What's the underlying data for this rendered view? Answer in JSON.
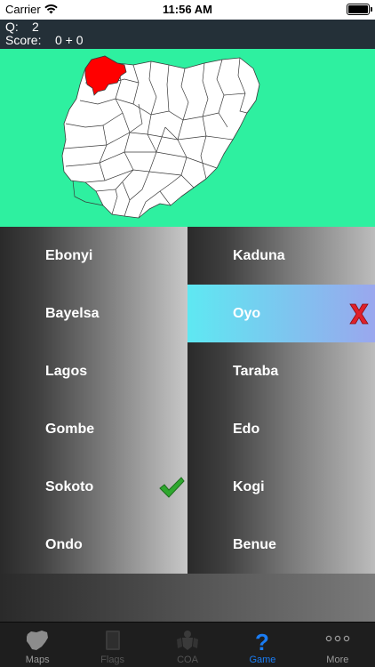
{
  "status": {
    "carrier": "Carrier",
    "time": "11:56 AM"
  },
  "info": {
    "q_label": "Q:",
    "q_value": "2",
    "score_label": "Score:",
    "score_value": "0 + 0"
  },
  "map": {
    "background_color": "#2ef0a0",
    "highlight_color": "#ff0000"
  },
  "answers": {
    "left": [
      {
        "label": "Ebonyi",
        "state": "normal"
      },
      {
        "label": "Bayelsa",
        "state": "normal"
      },
      {
        "label": "Lagos",
        "state": "normal"
      },
      {
        "label": "Gombe",
        "state": "normal"
      },
      {
        "label": "Sokoto",
        "state": "correct",
        "mark_icon": "checkmark-icon"
      },
      {
        "label": "Ondo",
        "state": "normal"
      }
    ],
    "right": [
      {
        "label": "Kaduna",
        "state": "normal"
      },
      {
        "label": "Oyo",
        "state": "wrong",
        "mark_icon": "x-mark-icon"
      },
      {
        "label": "Taraba",
        "state": "normal"
      },
      {
        "label": "Edo",
        "state": "normal"
      },
      {
        "label": "Kogi",
        "state": "normal"
      },
      {
        "label": "Benue",
        "state": "normal"
      }
    ]
  },
  "tabs": [
    {
      "label": "Maps",
      "icon": "map-icon",
      "state": "normal"
    },
    {
      "label": "Flags",
      "icon": "flag-book-icon",
      "state": "disabled"
    },
    {
      "label": "COA",
      "icon": "coat-of-arms-icon",
      "state": "disabled"
    },
    {
      "label": "Game",
      "icon": "question-icon",
      "state": "active"
    },
    {
      "label": "More",
      "icon": "more-icon",
      "state": "normal"
    }
  ],
  "colors": {
    "header_bg": "#243038",
    "active_tab": "#1a7cf3",
    "correct": "#2ea82e",
    "wrong": "#e0202a"
  }
}
